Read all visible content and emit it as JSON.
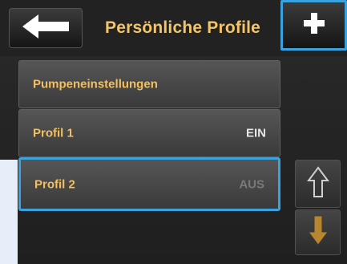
{
  "header": {
    "title": "Persönliche Profile",
    "back_icon": "arrow-left-icon",
    "add_icon": "plus-icon"
  },
  "list": [
    {
      "label": "Pumpeneinstellungen",
      "value": ""
    },
    {
      "label": "Profil 1",
      "value": "EIN"
    },
    {
      "label": "Profil 2",
      "value": "AUS"
    }
  ],
  "scroll": {
    "up_icon": "arrow-up-icon",
    "down_icon": "arrow-down-icon"
  },
  "colors": {
    "accent": "#3aa2de",
    "label": "#f2c062",
    "background": "#222222"
  }
}
